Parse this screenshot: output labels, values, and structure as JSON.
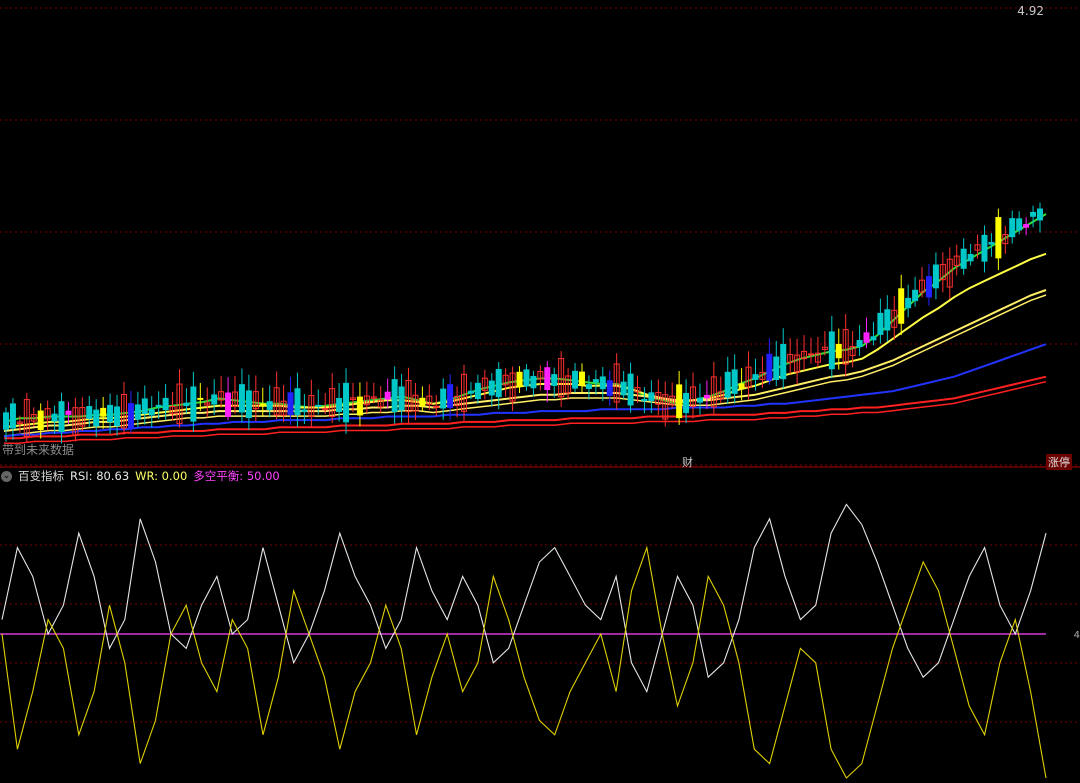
{
  "header": {
    "price_label": "4.92",
    "future_note": "带到未来数据",
    "cai_label": "财",
    "zhangting_label": "涨停"
  },
  "indicator": {
    "name": "百变指标",
    "rsi": "RSI: 80.63",
    "wr": "WR: 0.00",
    "balance": "多空平衡: 50.00",
    "right_tick": "4"
  },
  "colors": {
    "background": "#000000",
    "grid": "#7a0000",
    "bull": "#ff3030",
    "bear": "#00c8c8",
    "ma_green": "#33dd33",
    "ma_yellow": "#ffff44",
    "ma_yellow2": "#ffee66",
    "ma_blue": "#2233ff",
    "ma_red": "#ff2020",
    "rsi_line": "#e6e6e6",
    "wr_line": "#e0d000",
    "balance_line": "#ff44ff",
    "highlight_yellow": "#ffff00",
    "highlight_magenta": "#ff22ff",
    "highlight_blue": "#2222ff",
    "highlight_cyan": "#44ffff"
  },
  "chart_data": {
    "type": "line",
    "panels": [
      "price",
      "indicator"
    ],
    "price": {
      "series": [
        {
          "values": [
            10,
            12,
            12,
            13,
            13,
            13,
            14,
            14,
            15,
            16,
            18,
            19,
            20,
            21,
            23,
            22,
            21,
            20,
            20,
            19,
            18,
            19,
            20,
            21,
            22,
            23,
            24,
            22,
            20,
            22,
            25,
            28,
            30,
            32,
            33,
            34,
            34,
            33,
            32,
            31,
            31,
            28,
            24,
            22,
            20,
            22,
            24,
            27,
            31,
            34,
            38,
            42,
            45,
            47,
            49,
            50,
            52,
            58,
            66,
            74,
            82,
            88,
            95,
            100,
            105,
            110,
            115,
            120,
            125
          ]
        },
        {
          "values": [
            7,
            8,
            9,
            10,
            10,
            11,
            12,
            12,
            13,
            14,
            15,
            16,
            17,
            18,
            19,
            19,
            19,
            19,
            19,
            18,
            18,
            18,
            19,
            20,
            21,
            22,
            22,
            21,
            20,
            21,
            23,
            25,
            27,
            29,
            30,
            31,
            31,
            31,
            30,
            30,
            30,
            28,
            25,
            23,
            21,
            22,
            23,
            25,
            28,
            30,
            33,
            36,
            38,
            40,
            42,
            43,
            45,
            50,
            56,
            62,
            68,
            73,
            79,
            84,
            88,
            92,
            96,
            100,
            103
          ]
        },
        {
          "values": [
            5,
            6,
            7,
            8,
            8,
            9,
            10,
            10,
            11,
            12,
            13,
            14,
            15,
            15,
            16,
            16,
            16,
            16,
            16,
            16,
            16,
            16,
            17,
            17,
            18,
            18,
            19,
            19,
            18,
            19,
            20,
            21,
            22,
            23,
            24,
            25,
            25,
            26,
            26,
            26,
            26,
            25,
            24,
            23,
            22,
            22,
            22,
            23,
            24,
            25,
            27,
            29,
            31,
            33,
            35,
            36,
            38,
            41,
            44,
            48,
            52,
            56,
            60,
            64,
            68,
            72,
            76,
            80,
            83
          ]
        },
        {
          "values": [
            2,
            3,
            3,
            4,
            4,
            5,
            5,
            6,
            6,
            7,
            7,
            8,
            8,
            9,
            9,
            10,
            10,
            10,
            11,
            11,
            11,
            11,
            12,
            12,
            12,
            13,
            13,
            13,
            13,
            14,
            14,
            14,
            15,
            15,
            15,
            16,
            16,
            16,
            16,
            17,
            17,
            17,
            17,
            17,
            18,
            18,
            18,
            18,
            19,
            19,
            20,
            20,
            21,
            22,
            23,
            24,
            25,
            26,
            27,
            29,
            31,
            33,
            35,
            38,
            41,
            44,
            47,
            50,
            53
          ]
        },
        {
          "values": [
            1,
            1,
            2,
            2,
            2,
            3,
            3,
            3,
            4,
            4,
            4,
            5,
            5,
            5,
            6,
            6,
            6,
            6,
            7,
            7,
            7,
            7,
            8,
            8,
            8,
            8,
            9,
            9,
            9,
            9,
            10,
            10,
            10,
            11,
            11,
            11,
            11,
            12,
            12,
            12,
            12,
            12,
            13,
            13,
            13,
            13,
            14,
            14,
            14,
            14,
            15,
            15,
            16,
            16,
            17,
            17,
            18,
            18,
            19,
            20,
            21,
            22,
            23,
            25,
            27,
            29,
            31,
            33,
            35
          ]
        }
      ]
    },
    "indicator": {
      "balance": 50,
      "series": [
        {
          "values": [
            55,
            80,
            70,
            50,
            60,
            85,
            70,
            45,
            55,
            90,
            75,
            50,
            45,
            60,
            70,
            50,
            55,
            80,
            60,
            40,
            50,
            65,
            85,
            70,
            60,
            45,
            55,
            80,
            65,
            55,
            70,
            60,
            40,
            45,
            60,
            75,
            80,
            70,
            60,
            55,
            70,
            40,
            30,
            50,
            70,
            60,
            35,
            40,
            55,
            80,
            90,
            70,
            55,
            60,
            85,
            95,
            88,
            75,
            60,
            45,
            35,
            40,
            55,
            70,
            80,
            60,
            50,
            65,
            85
          ]
        },
        {
          "values": [
            50,
            10,
            30,
            55,
            45,
            15,
            30,
            60,
            40,
            5,
            20,
            50,
            60,
            40,
            30,
            55,
            45,
            15,
            35,
            65,
            50,
            35,
            10,
            30,
            40,
            60,
            45,
            15,
            35,
            50,
            30,
            40,
            70,
            55,
            35,
            20,
            15,
            30,
            40,
            50,
            30,
            65,
            80,
            50,
            25,
            40,
            70,
            60,
            40,
            10,
            5,
            25,
            45,
            40,
            10,
            0,
            5,
            25,
            45,
            60,
            75,
            65,
            45,
            25,
            15,
            40,
            55,
            30,
            0
          ]
        }
      ]
    }
  }
}
